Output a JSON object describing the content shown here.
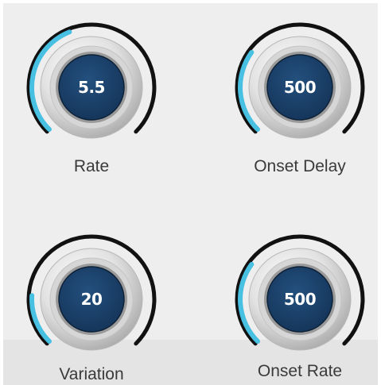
{
  "colors": {
    "arc_active": "#48c0e2",
    "arc_track": "#111111",
    "knob_face": "#15355a",
    "panel_bg": "#eeeeee",
    "label_text": "#3a3a3a"
  },
  "knobs": [
    {
      "id": "rate",
      "label": "Rate",
      "value": "5.5",
      "level": 0.42
    },
    {
      "id": "onset_delay",
      "label": "Onset Delay",
      "value": "500",
      "level": 0.3
    },
    {
      "id": "variation",
      "label": "Variation",
      "value": "20",
      "level": 0.18
    },
    {
      "id": "onset_rate",
      "label": "Onset Rate",
      "value": "500",
      "level": 0.3
    }
  ]
}
